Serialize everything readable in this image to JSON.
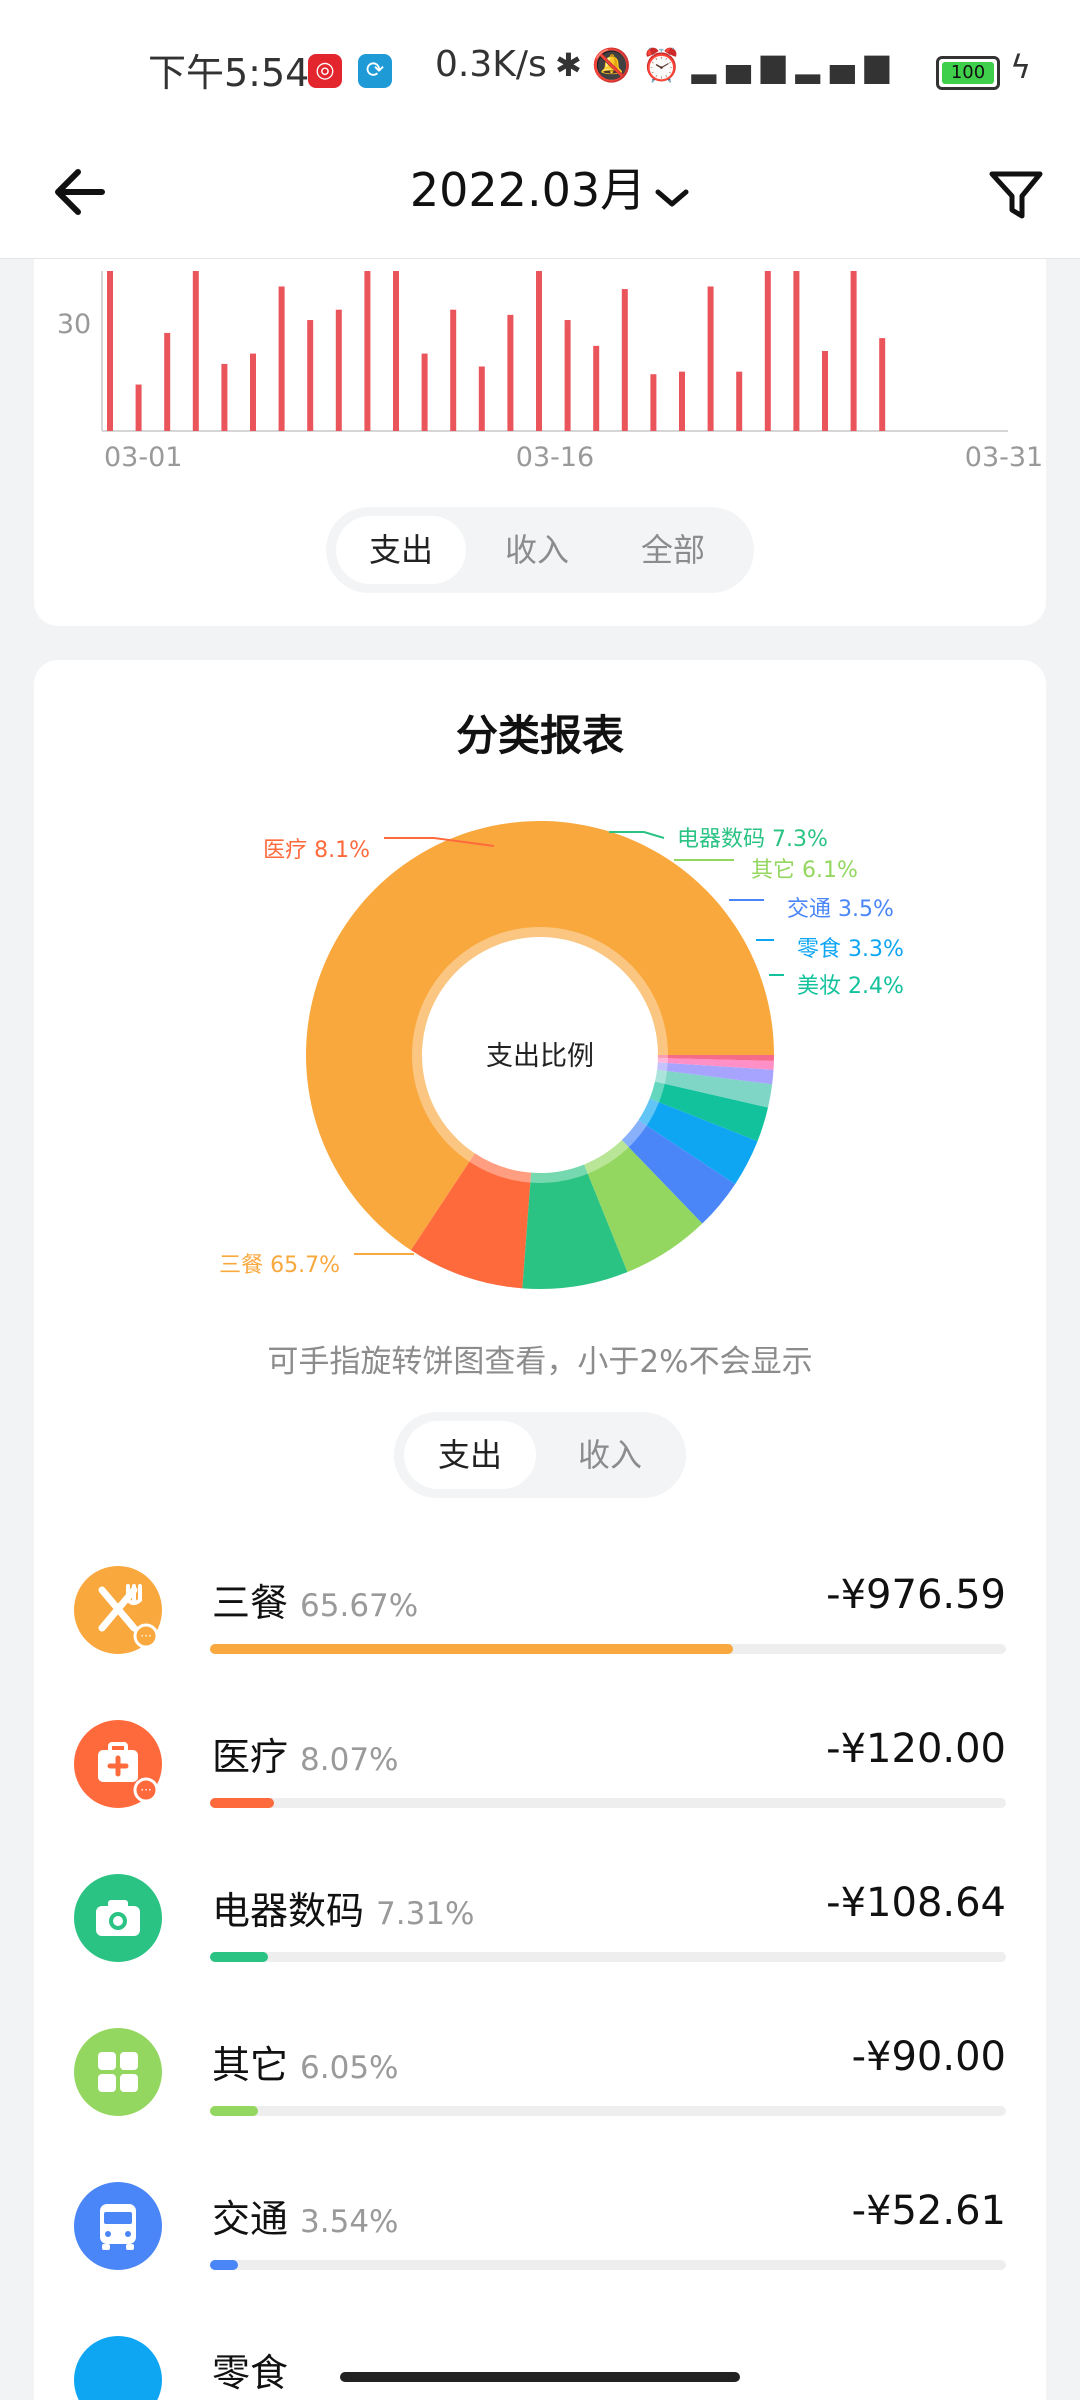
{
  "status_bar": {
    "time": "下午5:54",
    "network_speed": "0.3K/s",
    "battery": "100"
  },
  "navbar": {
    "title": "2022.03月"
  },
  "daily_chart": {
    "y_tick": "30",
    "x_ticks": [
      "03-01",
      "03-16",
      "03-31"
    ],
    "segment": [
      "支出",
      "收入",
      "全部"
    ],
    "active_segment": 0
  },
  "chart_data": [
    {
      "type": "bar",
      "x_start": "03-01",
      "x_end": "03-31",
      "y_visible_tick": 30,
      "ylim_visible": [
        0,
        62
      ],
      "values": [
        62,
        18,
        38,
        62,
        26,
        30,
        56,
        43,
        47,
        62,
        62,
        30,
        47,
        25,
        45,
        62,
        43,
        33,
        55,
        22,
        23,
        56,
        23,
        62,
        62,
        31,
        62,
        36
      ],
      "color": "#e9555b"
    },
    {
      "type": "pie",
      "title": "分类报表",
      "center_label": "支出比例",
      "slices": [
        {
          "label": "三餐",
          "value": 65.7,
          "color": "#f9a83e"
        },
        {
          "label": "医疗",
          "value": 8.1,
          "color": "#ff6a3d"
        },
        {
          "label": "电器数码",
          "value": 7.3,
          "color": "#2bc383"
        },
        {
          "label": "其它",
          "value": 6.1,
          "color": "#94d760"
        },
        {
          "label": "交通",
          "value": 3.5,
          "color": "#4a86f7"
        },
        {
          "label": "零食",
          "value": 3.3,
          "color": "#0ea6f2"
        },
        {
          "label": "美妆",
          "value": 2.4,
          "color": "#12c29c"
        },
        {
          "label": "",
          "value": 1.6,
          "color": "#7fd6c6"
        },
        {
          "label": "",
          "value": 1.0,
          "color": "#a7a4ff"
        },
        {
          "label": "",
          "value": 0.6,
          "color": "#ff8fc7"
        },
        {
          "label": "",
          "value": 0.4,
          "color": "#f76b8a"
        }
      ],
      "callouts": [
        {
          "text": "医疗 8.1%",
          "color": "#ff6a3d"
        },
        {
          "text": "电器数码 7.3%",
          "color": "#2bc383"
        },
        {
          "text": "其它 6.1%",
          "color": "#94d760"
        },
        {
          "text": "交通 3.5%",
          "color": "#4a86f7"
        },
        {
          "text": "零食 3.3%",
          "color": "#0ea6f2"
        },
        {
          "text": "美妆 2.4%",
          "color": "#12c29c"
        },
        {
          "text": "三餐 65.7%",
          "color": "#f9a83e"
        }
      ]
    }
  ],
  "report": {
    "hint": "可手指旋转饼图查看，小于2%不会显示",
    "segment": [
      "支出",
      "收入"
    ],
    "active_segment": 0
  },
  "categories": [
    {
      "name": "三餐",
      "percent": "65.67%",
      "amount": "-¥976.59",
      "ratio": 0.6567,
      "color": "#f9a83e",
      "icon": "fork-knife-icon"
    },
    {
      "name": "医疗",
      "percent": "8.07%",
      "amount": "-¥120.00",
      "ratio": 0.0807,
      "color": "#ff6a3d",
      "icon": "medical-kit-icon"
    },
    {
      "name": "电器数码",
      "percent": "7.31%",
      "amount": "-¥108.64",
      "ratio": 0.0731,
      "color": "#2bc383",
      "icon": "camera-icon"
    },
    {
      "name": "其它",
      "percent": "6.05%",
      "amount": "-¥90.00",
      "ratio": 0.0605,
      "color": "#94d760",
      "icon": "grid-icon"
    },
    {
      "name": "交通",
      "percent": "3.54%",
      "amount": "-¥52.61",
      "ratio": 0.0354,
      "color": "#4a86f7",
      "icon": "bus-icon"
    },
    {
      "name": "零食",
      "percent": "",
      "amount": "",
      "ratio": 0.033,
      "color": "#0ea6f2",
      "icon": "snack-icon"
    }
  ]
}
